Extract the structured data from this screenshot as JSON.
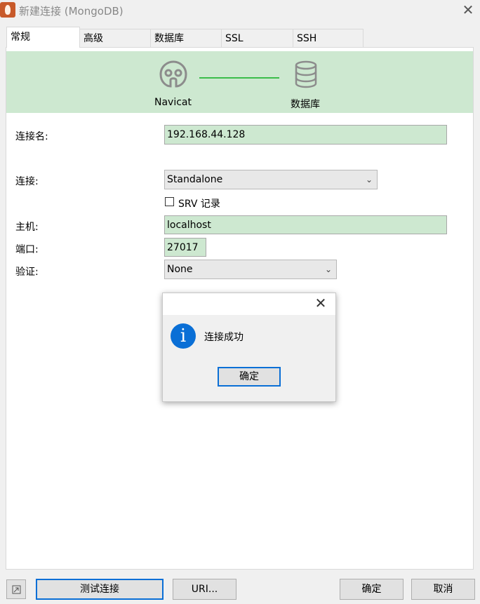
{
  "window": {
    "title": "新建连接 (MongoDB)"
  },
  "tabs": [
    {
      "label": "常规",
      "active": true
    },
    {
      "label": "高级",
      "active": false
    },
    {
      "label": "数据库",
      "active": false
    },
    {
      "label": "SSL",
      "active": false
    },
    {
      "label": "SSH",
      "active": false
    }
  ],
  "banner": {
    "left_label": "Navicat",
    "right_label": "数据库"
  },
  "form": {
    "name_label": "连接名:",
    "name_value": "192.168.44.128",
    "connection_label": "连接:",
    "connection_value": "Standalone",
    "srv_label": "SRV 记录",
    "srv_checked": false,
    "host_label": "主机:",
    "host_value": "localhost",
    "port_label": "端口:",
    "port_value": "27017",
    "auth_label": "验证:",
    "auth_value": "None"
  },
  "dialog": {
    "message": "连接成功",
    "ok_label": "确定"
  },
  "footer": {
    "test_label": "测试连接",
    "uri_label": "URI...",
    "ok_label": "确定",
    "cancel_label": "取消"
  },
  "colors": {
    "field_bg": "#cde8d0",
    "accent": "#0a6fd6",
    "link_line": "#3bbd4a"
  }
}
